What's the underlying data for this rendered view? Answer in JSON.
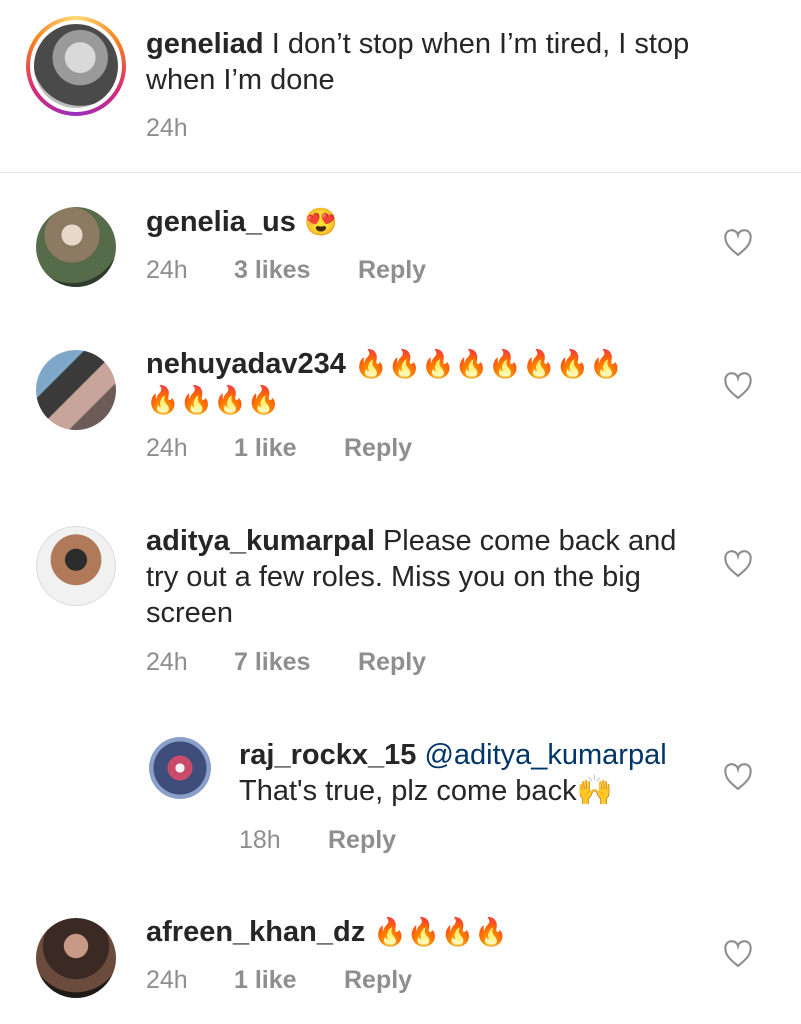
{
  "caption": {
    "username": "geneliad",
    "text": "I don’t stop when I’m tired, I stop when I’m done",
    "time": "24h"
  },
  "comments": [
    {
      "username": "genelia_us",
      "text": "😍",
      "time": "24h",
      "likes": "3 likes",
      "reply": "Reply"
    },
    {
      "username": "nehuyadav234",
      "text": "🔥🔥🔥🔥🔥🔥🔥🔥",
      "text2": "🔥🔥🔥🔥",
      "time": "24h",
      "likes": "1 like",
      "reply": "Reply"
    },
    {
      "username": "aditya_kumarpal",
      "text": "Please come back and",
      "text2": "try out a few roles. Miss you on the big",
      "text3": "screen",
      "time": "24h",
      "likes": "7 likes",
      "reply": "Reply"
    },
    {
      "username": "raj_rockx_15",
      "mention": "@aditya_kumarpal",
      "text": "That's true, plz come back🙌",
      "time": "18h",
      "reply": "Reply"
    },
    {
      "username": "afreen_khan_dz",
      "text": "🔥🔥🔥🔥",
      "time": "24h",
      "likes": "1 like",
      "reply": "Reply"
    }
  ],
  "icons": {
    "heart": "heart-outline-icon",
    "story_ring_colors": [
      "#feda75",
      "#fa7e1e",
      "#d62976",
      "#962fbf"
    ]
  }
}
